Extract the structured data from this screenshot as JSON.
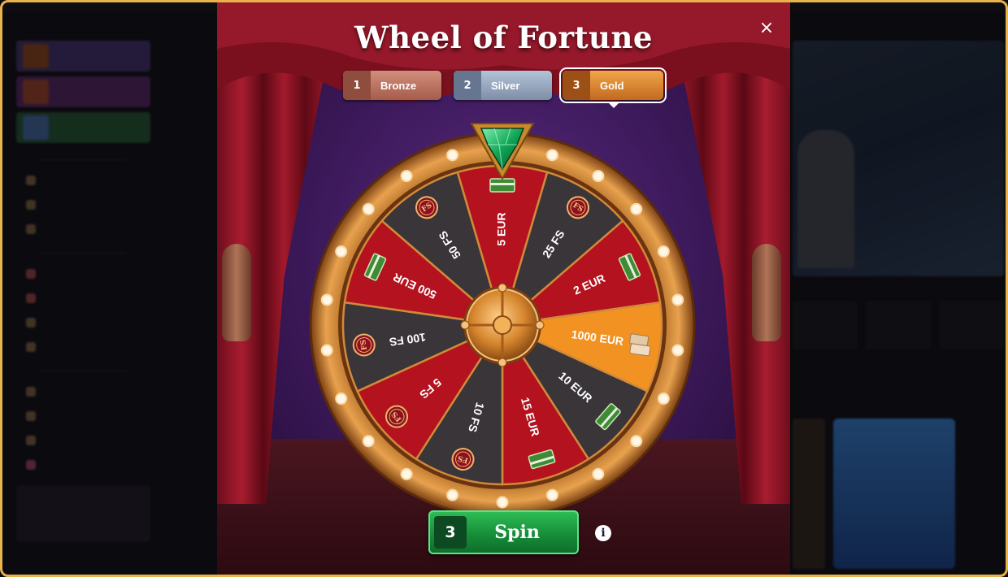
{
  "modal": {
    "title": "Wheel of Fortune",
    "close_icon": "×",
    "info_icon": "i"
  },
  "tiers": [
    {
      "number": "1",
      "label": "Bronze",
      "color": "#b86d5a"
    },
    {
      "number": "2",
      "label": "Silver",
      "color": "#9aa9bf"
    },
    {
      "number": "3",
      "label": "Gold",
      "color": "#e08a34",
      "selected": true
    }
  ],
  "wheel": {
    "pointer_icon": "emerald-gem-icon",
    "segments": [
      {
        "label": "5 EUR",
        "icon": "cash-icon",
        "color": "#b3121e"
      },
      {
        "label": "25 FS",
        "icon": "fs-chip-icon",
        "color": "#3a3538"
      },
      {
        "label": "2 EUR",
        "icon": "cash-icon",
        "color": "#b3121e"
      },
      {
        "label": "1000 EUR",
        "icon": "gold-bars-icon",
        "color": "#f29222"
      },
      {
        "label": "10 EUR",
        "icon": "cash-icon",
        "color": "#3a3538"
      },
      {
        "label": "15 EUR",
        "icon": "cash-icon",
        "color": "#b3121e"
      },
      {
        "label": "10 FS",
        "icon": "fs-chip-icon",
        "color": "#3a3538"
      },
      {
        "label": "5 FS",
        "icon": "fs-chip-icon",
        "color": "#b3121e"
      },
      {
        "label": "100 FS",
        "icon": "fs-chip-icon",
        "color": "#3a3538"
      },
      {
        "label": "500 EUR",
        "icon": "cash-icon",
        "color": "#b3121e"
      },
      {
        "label": "50 FS",
        "icon": "fs-chip-icon",
        "color": "#3a3538"
      }
    ],
    "chip_text": "FS"
  },
  "spin": {
    "count": "3",
    "label": "Spin"
  }
}
